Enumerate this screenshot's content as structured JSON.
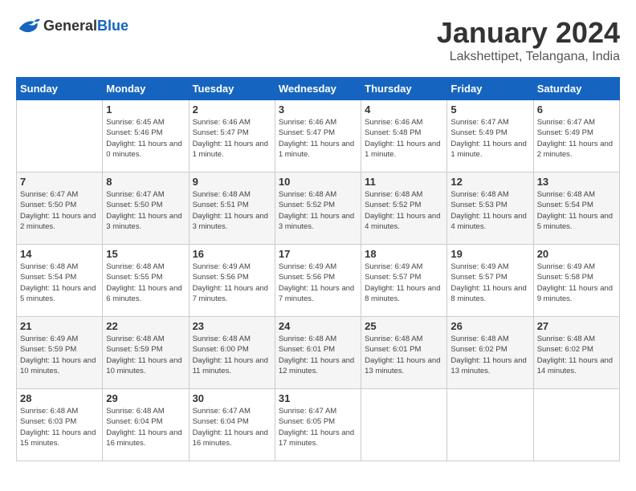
{
  "logo": {
    "general": "General",
    "blue": "Blue"
  },
  "header": {
    "title": "January 2024",
    "subtitle": "Lakshettipet, Telangana, India"
  },
  "weekdays": [
    "Sunday",
    "Monday",
    "Tuesday",
    "Wednesday",
    "Thursday",
    "Friday",
    "Saturday"
  ],
  "weeks": [
    {
      "days": [
        {
          "num": "",
          "sunrise": "",
          "sunset": "",
          "daylight": ""
        },
        {
          "num": "1",
          "sunrise": "Sunrise: 6:45 AM",
          "sunset": "Sunset: 5:46 PM",
          "daylight": "Daylight: 11 hours and 0 minutes."
        },
        {
          "num": "2",
          "sunrise": "Sunrise: 6:46 AM",
          "sunset": "Sunset: 5:47 PM",
          "daylight": "Daylight: 11 hours and 1 minute."
        },
        {
          "num": "3",
          "sunrise": "Sunrise: 6:46 AM",
          "sunset": "Sunset: 5:47 PM",
          "daylight": "Daylight: 11 hours and 1 minute."
        },
        {
          "num": "4",
          "sunrise": "Sunrise: 6:46 AM",
          "sunset": "Sunset: 5:48 PM",
          "daylight": "Daylight: 11 hours and 1 minute."
        },
        {
          "num": "5",
          "sunrise": "Sunrise: 6:47 AM",
          "sunset": "Sunset: 5:49 PM",
          "daylight": "Daylight: 11 hours and 1 minute."
        },
        {
          "num": "6",
          "sunrise": "Sunrise: 6:47 AM",
          "sunset": "Sunset: 5:49 PM",
          "daylight": "Daylight: 11 hours and 2 minutes."
        }
      ]
    },
    {
      "days": [
        {
          "num": "7",
          "sunrise": "Sunrise: 6:47 AM",
          "sunset": "Sunset: 5:50 PM",
          "daylight": "Daylight: 11 hours and 2 minutes."
        },
        {
          "num": "8",
          "sunrise": "Sunrise: 6:47 AM",
          "sunset": "Sunset: 5:50 PM",
          "daylight": "Daylight: 11 hours and 3 minutes."
        },
        {
          "num": "9",
          "sunrise": "Sunrise: 6:48 AM",
          "sunset": "Sunset: 5:51 PM",
          "daylight": "Daylight: 11 hours and 3 minutes."
        },
        {
          "num": "10",
          "sunrise": "Sunrise: 6:48 AM",
          "sunset": "Sunset: 5:52 PM",
          "daylight": "Daylight: 11 hours and 3 minutes."
        },
        {
          "num": "11",
          "sunrise": "Sunrise: 6:48 AM",
          "sunset": "Sunset: 5:52 PM",
          "daylight": "Daylight: 11 hours and 4 minutes."
        },
        {
          "num": "12",
          "sunrise": "Sunrise: 6:48 AM",
          "sunset": "Sunset: 5:53 PM",
          "daylight": "Daylight: 11 hours and 4 minutes."
        },
        {
          "num": "13",
          "sunrise": "Sunrise: 6:48 AM",
          "sunset": "Sunset: 5:54 PM",
          "daylight": "Daylight: 11 hours and 5 minutes."
        }
      ]
    },
    {
      "days": [
        {
          "num": "14",
          "sunrise": "Sunrise: 6:48 AM",
          "sunset": "Sunset: 5:54 PM",
          "daylight": "Daylight: 11 hours and 5 minutes."
        },
        {
          "num": "15",
          "sunrise": "Sunrise: 6:48 AM",
          "sunset": "Sunset: 5:55 PM",
          "daylight": "Daylight: 11 hours and 6 minutes."
        },
        {
          "num": "16",
          "sunrise": "Sunrise: 6:49 AM",
          "sunset": "Sunset: 5:56 PM",
          "daylight": "Daylight: 11 hours and 7 minutes."
        },
        {
          "num": "17",
          "sunrise": "Sunrise: 6:49 AM",
          "sunset": "Sunset: 5:56 PM",
          "daylight": "Daylight: 11 hours and 7 minutes."
        },
        {
          "num": "18",
          "sunrise": "Sunrise: 6:49 AM",
          "sunset": "Sunset: 5:57 PM",
          "daylight": "Daylight: 11 hours and 8 minutes."
        },
        {
          "num": "19",
          "sunrise": "Sunrise: 6:49 AM",
          "sunset": "Sunset: 5:57 PM",
          "daylight": "Daylight: 11 hours and 8 minutes."
        },
        {
          "num": "20",
          "sunrise": "Sunrise: 6:49 AM",
          "sunset": "Sunset: 5:58 PM",
          "daylight": "Daylight: 11 hours and 9 minutes."
        }
      ]
    },
    {
      "days": [
        {
          "num": "21",
          "sunrise": "Sunrise: 6:49 AM",
          "sunset": "Sunset: 5:59 PM",
          "daylight": "Daylight: 11 hours and 10 minutes."
        },
        {
          "num": "22",
          "sunrise": "Sunrise: 6:48 AM",
          "sunset": "Sunset: 5:59 PM",
          "daylight": "Daylight: 11 hours and 10 minutes."
        },
        {
          "num": "23",
          "sunrise": "Sunrise: 6:48 AM",
          "sunset": "Sunset: 6:00 PM",
          "daylight": "Daylight: 11 hours and 11 minutes."
        },
        {
          "num": "24",
          "sunrise": "Sunrise: 6:48 AM",
          "sunset": "Sunset: 6:01 PM",
          "daylight": "Daylight: 11 hours and 12 minutes."
        },
        {
          "num": "25",
          "sunrise": "Sunrise: 6:48 AM",
          "sunset": "Sunset: 6:01 PM",
          "daylight": "Daylight: 11 hours and 13 minutes."
        },
        {
          "num": "26",
          "sunrise": "Sunrise: 6:48 AM",
          "sunset": "Sunset: 6:02 PM",
          "daylight": "Daylight: 11 hours and 13 minutes."
        },
        {
          "num": "27",
          "sunrise": "Sunrise: 6:48 AM",
          "sunset": "Sunset: 6:02 PM",
          "daylight": "Daylight: 11 hours and 14 minutes."
        }
      ]
    },
    {
      "days": [
        {
          "num": "28",
          "sunrise": "Sunrise: 6:48 AM",
          "sunset": "Sunset: 6:03 PM",
          "daylight": "Daylight: 11 hours and 15 minutes."
        },
        {
          "num": "29",
          "sunrise": "Sunrise: 6:48 AM",
          "sunset": "Sunset: 6:04 PM",
          "daylight": "Daylight: 11 hours and 16 minutes."
        },
        {
          "num": "30",
          "sunrise": "Sunrise: 6:47 AM",
          "sunset": "Sunset: 6:04 PM",
          "daylight": "Daylight: 11 hours and 16 minutes."
        },
        {
          "num": "31",
          "sunrise": "Sunrise: 6:47 AM",
          "sunset": "Sunset: 6:05 PM",
          "daylight": "Daylight: 11 hours and 17 minutes."
        },
        {
          "num": "",
          "sunrise": "",
          "sunset": "",
          "daylight": ""
        },
        {
          "num": "",
          "sunrise": "",
          "sunset": "",
          "daylight": ""
        },
        {
          "num": "",
          "sunrise": "",
          "sunset": "",
          "daylight": ""
        }
      ]
    }
  ]
}
